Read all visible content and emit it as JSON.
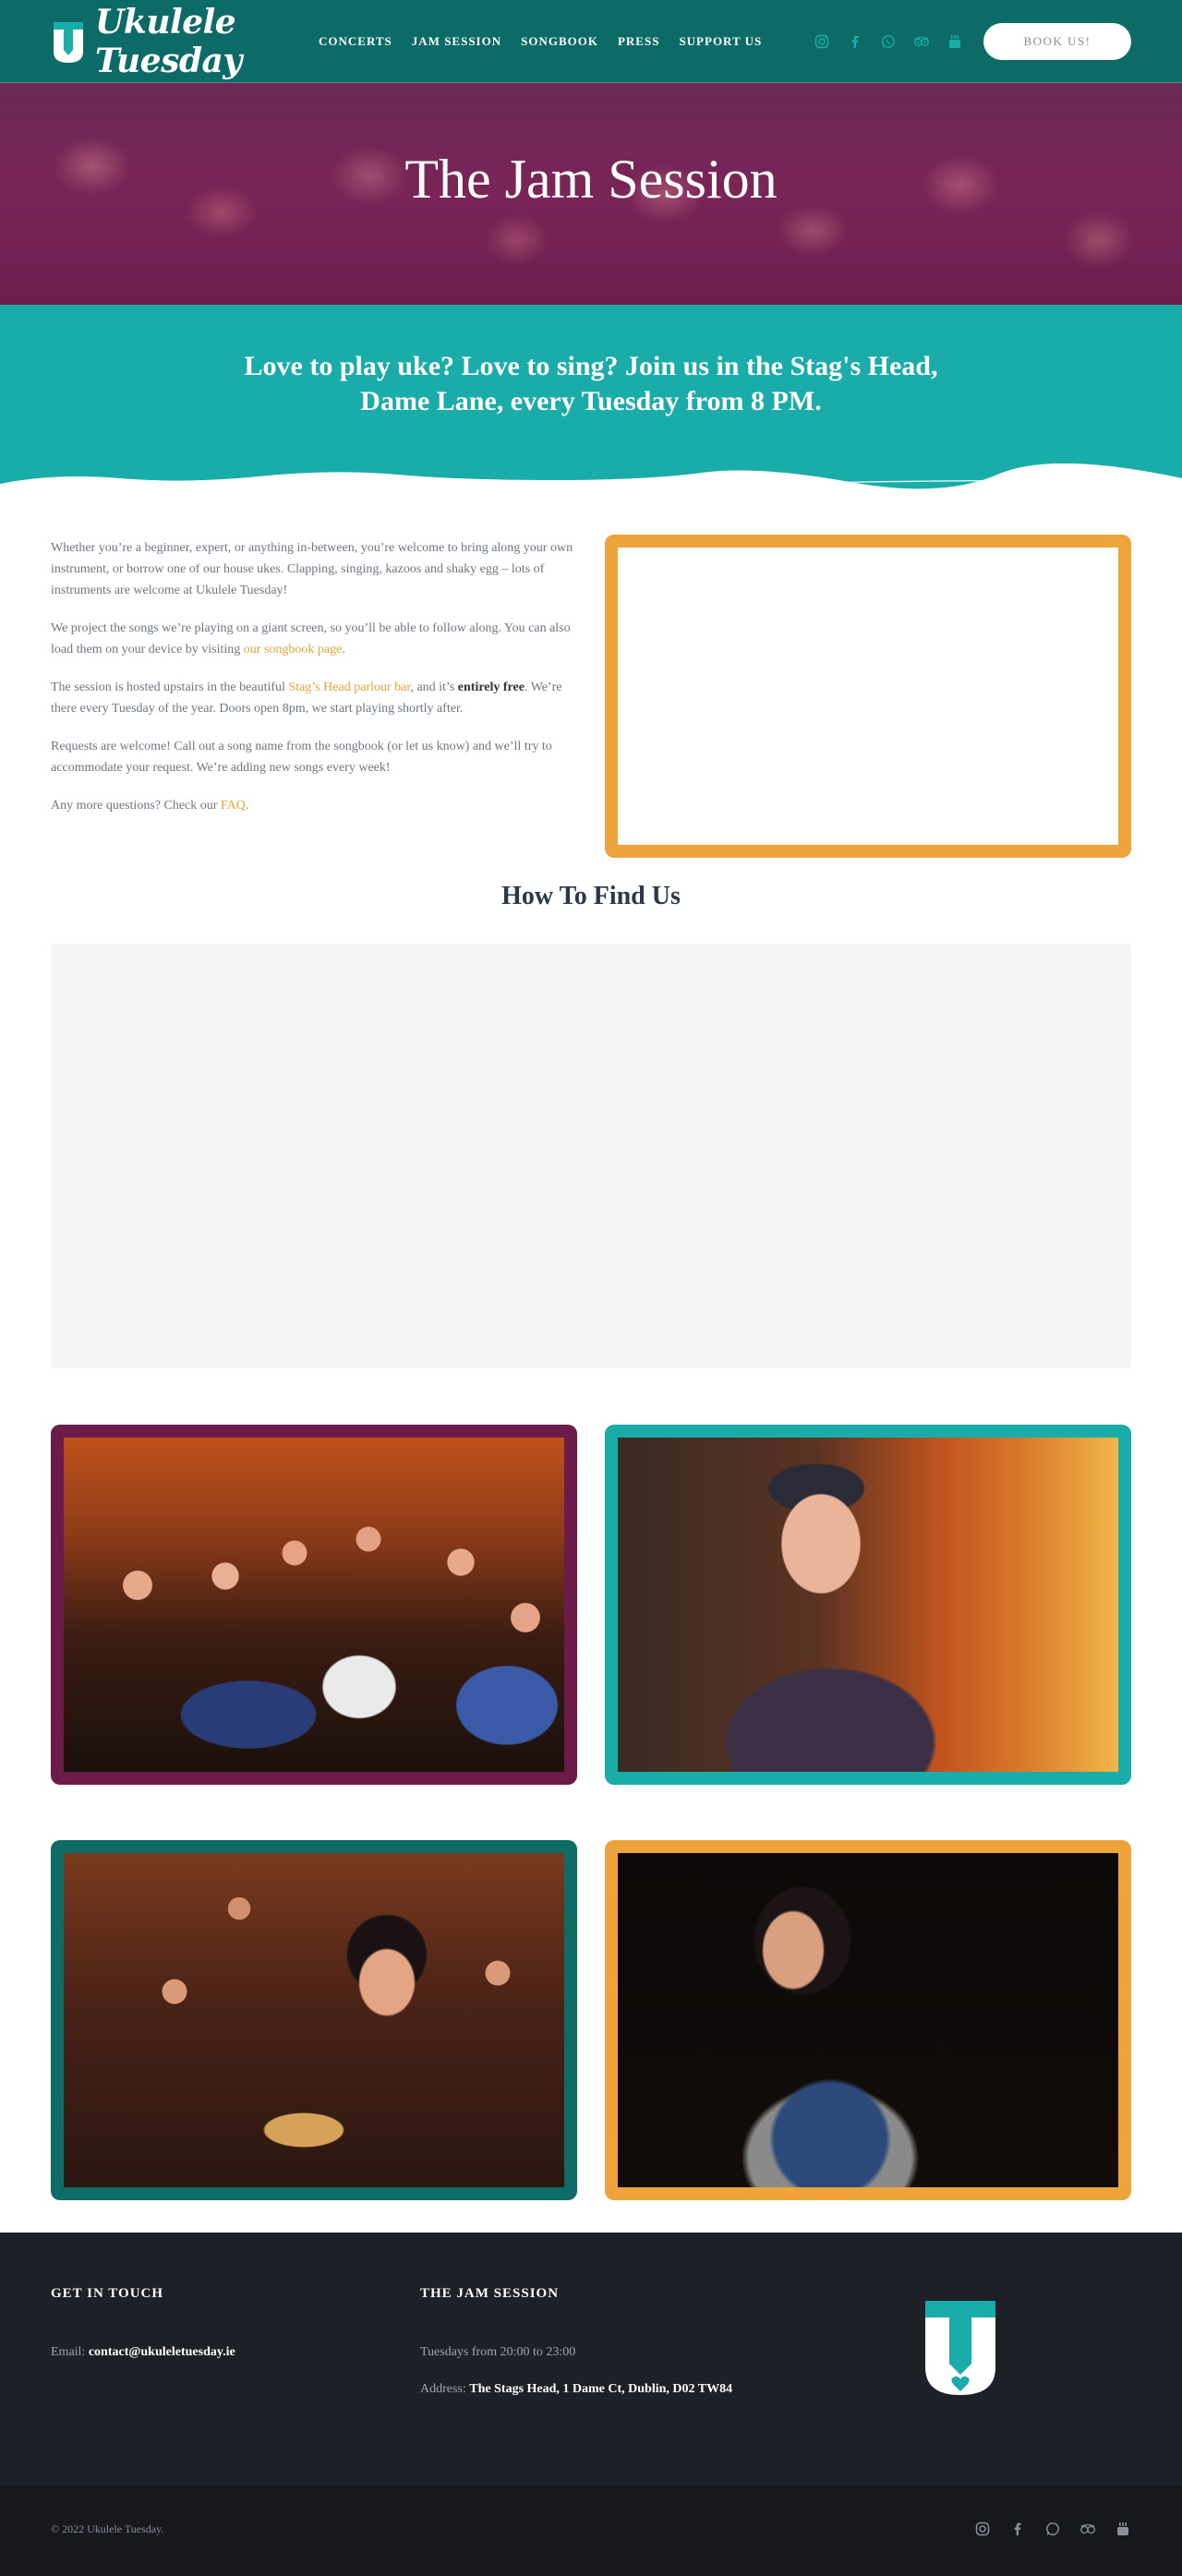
{
  "brand": {
    "name": "Ukulele Tuesday",
    "teal": "#1aaca8",
    "dark_teal": "#0c6b66",
    "purple": "#6b1a4a",
    "orange": "#eea43a"
  },
  "nav": {
    "items": [
      "CONCERTS",
      "JAM SESSION",
      "SONGBOOK",
      "PRESS",
      "SUPPORT US"
    ],
    "social_icons": [
      "instagram-icon",
      "facebook-icon",
      "whatsapp-icon",
      "tripadvisor-icon",
      "youtube-icon"
    ],
    "cta": "BOOK US!"
  },
  "hero": {
    "title": "The Jam Session"
  },
  "band": {
    "line1": "Love to play uke? Love to sing? Join us in the Stag's Head,",
    "line2": "Dame Lane, every Tuesday from 8 PM."
  },
  "intro": {
    "p1": "Whether you’re a beginner, expert, or anything in-between, you’re welcome to bring along your own instrument, or borrow one of our house ukes. Clapping, singing, kazoos and shaky egg – lots of instruments are welcome at Ukulele Tuesday!",
    "p2_a": "We project the songs we’re playing on a giant screen, so you’ll be able to follow along. You can also load them on your device by visiting ",
    "p2_link": "our songbook page",
    "p2_b": ".",
    "p3_a": "The session is hosted upstairs in the beautiful ",
    "p3_link": "Stag’s Head parlour bar",
    "p3_b": ", and it’s ",
    "p3_bold": "entirely free",
    "p3_c": ". We’re there every Tuesday of the year. Doors open 8pm, we start playing shortly after.",
    "p4": "Requests are welcome! Call out a song name from the songbook (or let us know) and we’ll try to accommodate your request. We’re adding new songs every week!",
    "p5_a": "Any more questions? Check our ",
    "p5_link": "FAQ",
    "p5_b": "."
  },
  "find": {
    "title": "How To Find Us"
  },
  "footer": {
    "contact_heading": "GET IN TOUCH",
    "email_label": "Email: ",
    "email": "contact@ukuleletuesday.ie",
    "session_heading": "THE JAM SESSION",
    "hours": "Tuesdays from 20:00 to 23:00",
    "address_label": "Address: ",
    "address": "The Stags Head, 1 Dame Ct, Dublin, D02 TW84",
    "copyright": "© 2022 Ukulele Tuesday."
  }
}
